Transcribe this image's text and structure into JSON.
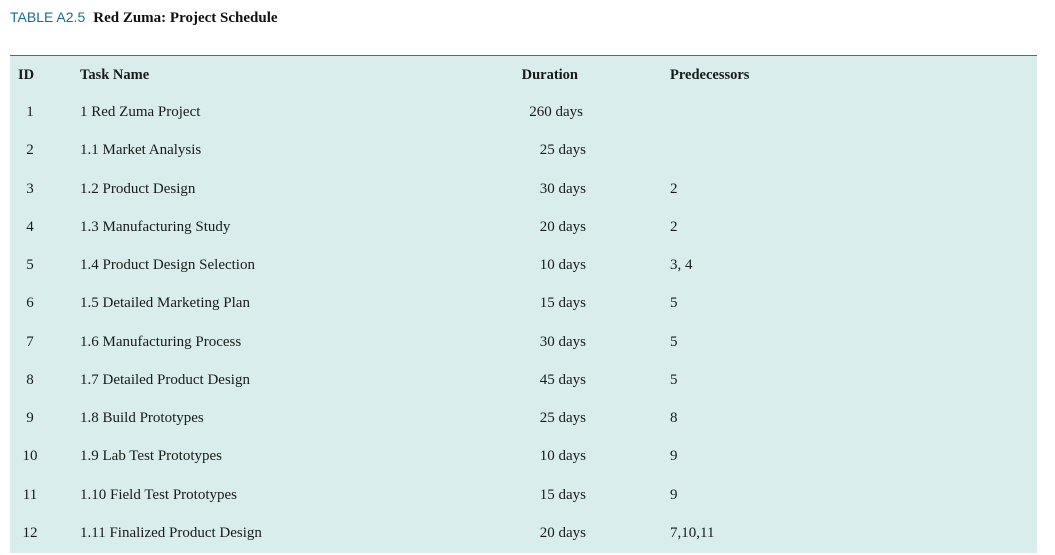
{
  "caption": {
    "number": "TABLE A2.5",
    "title": "Red Zuma: Project Schedule"
  },
  "table": {
    "headers": {
      "id": "ID",
      "task": "Task Name",
      "duration": "Duration",
      "predecessors": "Predecessors"
    },
    "rows": [
      {
        "id": "1",
        "task": "1 Red Zuma Project",
        "duration": "260 days",
        "predecessors": ""
      },
      {
        "id": "2",
        "task": "1.1 Market Analysis",
        "duration": "25 days",
        "predecessors": ""
      },
      {
        "id": "3",
        "task": "1.2 Product Design",
        "duration": "30 days",
        "predecessors": "2"
      },
      {
        "id": "4",
        "task": "1.3 Manufacturing Study",
        "duration": "20 days",
        "predecessors": "2"
      },
      {
        "id": "5",
        "task": "1.4 Product Design Selection",
        "duration": "10 days",
        "predecessors": "3, 4"
      },
      {
        "id": "6",
        "task": "1.5 Detailed Marketing Plan",
        "duration": "15 days",
        "predecessors": "5"
      },
      {
        "id": "7",
        "task": "1.6 Manufacturing Process",
        "duration": "30 days",
        "predecessors": "5"
      },
      {
        "id": "8",
        "task": "1.7 Detailed Product Design",
        "duration": "45 days",
        "predecessors": "5"
      },
      {
        "id": "9",
        "task": "1.8 Build Prototypes",
        "duration": "25 days",
        "predecessors": "8"
      },
      {
        "id": "10",
        "task": "1.9 Lab Test Prototypes",
        "duration": "10 days",
        "predecessors": "9"
      },
      {
        "id": "11",
        "task": "1.10 Field Test Prototypes",
        "duration": "15 days",
        "predecessors": "9"
      },
      {
        "id": "12",
        "task": "1.11 Finalized Product Design",
        "duration": "20 days",
        "predecessors": "7,10,11"
      }
    ]
  },
  "colors": {
    "caption_number": "#1b6e8a",
    "table_background": "#d9eeec",
    "table_top_rule": "#2a7e86"
  }
}
